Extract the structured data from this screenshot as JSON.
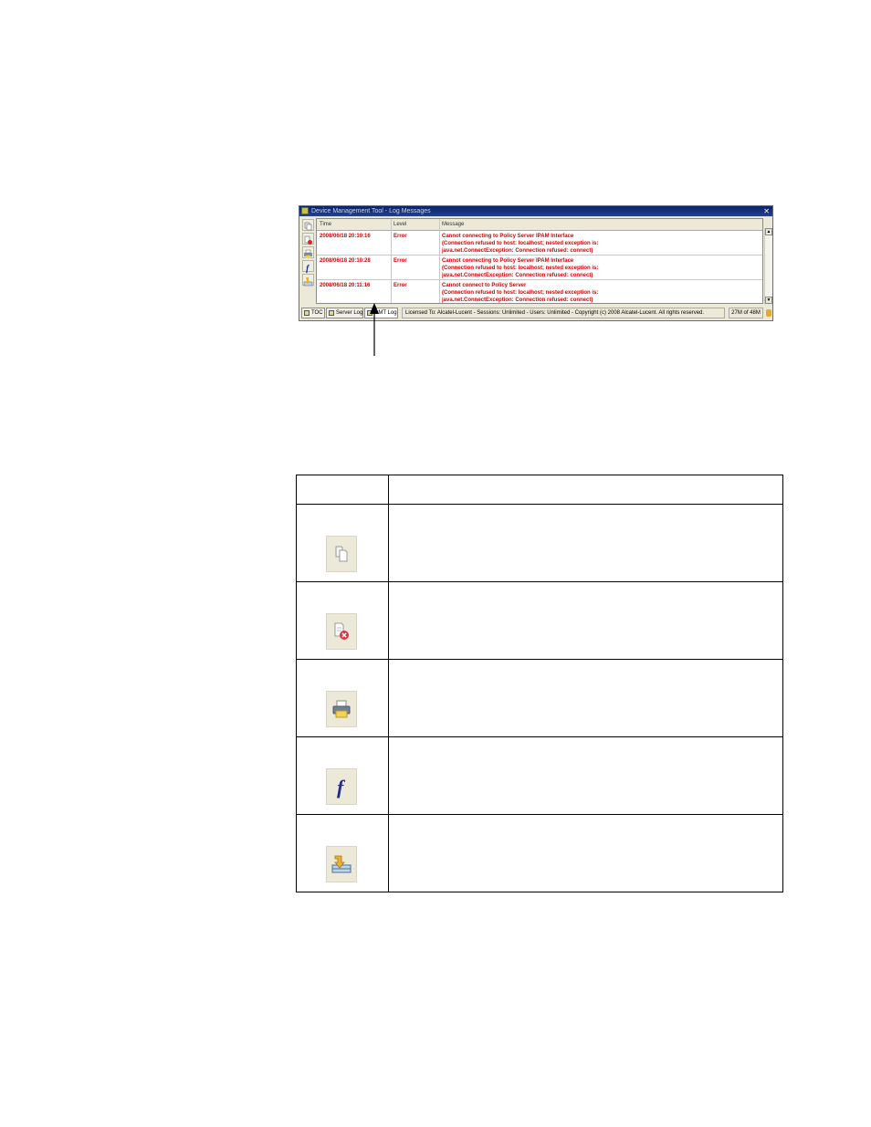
{
  "window": {
    "title": "Device Management Tool - Log Messages",
    "close_glyph": "✕",
    "columns": [
      "Time",
      "Level",
      "Message"
    ],
    "rows": [
      {
        "time": "2008/06/18 20:10:16",
        "level": "Error",
        "message": [
          "Cannot connecting to Policy Server IPAM Interface",
          "(Connection refused to host: localhost; nested exception is:",
          "java.net.ConnectException: Connection refused: connect)"
        ]
      },
      {
        "time": "2008/06/18 20:10:28",
        "level": "Error",
        "message": [
          "Cannot connecting to Policy Server IPAM Interface",
          "(Connection refused to host: localhost; nested exception is:",
          "java.net.ConnectException: Connection refused: connect)"
        ]
      },
      {
        "time": "2008/06/18 20:11:16",
        "level": "Error",
        "message": [
          "Cannot connect to Policy Server",
          "(Connection refused to host: localhost; nested exception is:",
          "java.net.ConnectException: Connection refused: connect)"
        ]
      }
    ],
    "scroll_up": "▲",
    "scroll_down": "▼",
    "status_tabs": [
      "TOC",
      "Server Log",
      "DMT Log"
    ],
    "licence": "Licensed To: Alcatel-Lucent - Sessions: Unlimited - Users: Unlimited - Copyright (c) 2008 Alcatel-Lucent. All rights reserved.",
    "memory": "27M of 48M",
    "error_color": "#d80000",
    "titlebar_color": "#0a246a"
  },
  "icon_table": {
    "rows": [
      {
        "icon": "copy-icon"
      },
      {
        "icon": "delete-log-icon"
      },
      {
        "icon": "print-icon"
      },
      {
        "icon": "filter-f-icon"
      },
      {
        "icon": "export-icon"
      }
    ]
  }
}
